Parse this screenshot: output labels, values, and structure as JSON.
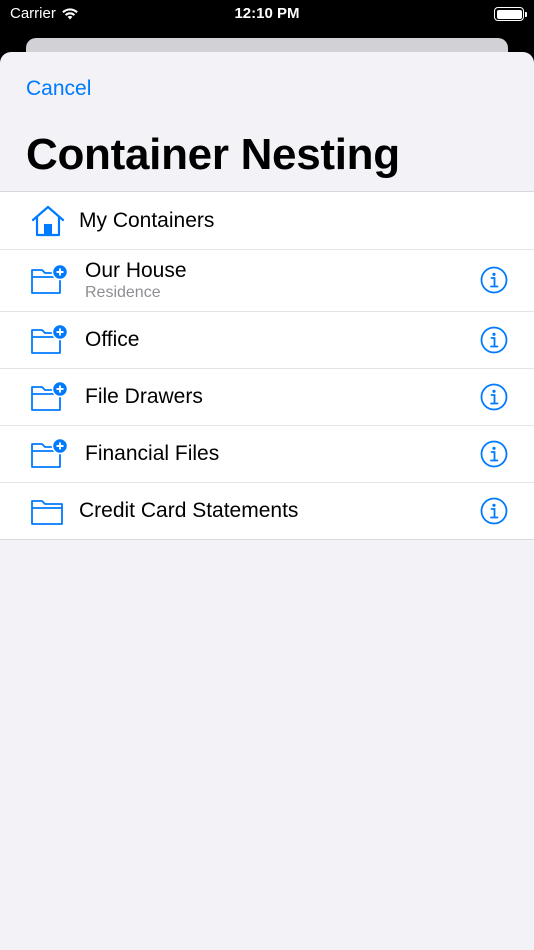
{
  "status_bar": {
    "carrier": "Carrier",
    "time": "12:10 PM",
    "battery_level": 1.0
  },
  "nav": {
    "cancel_label": "Cancel",
    "title": "Container Nesting"
  },
  "colors": {
    "accent": "#007aff",
    "sheet_bg": "#f2f2f7",
    "subtitle": "#8e8e93"
  },
  "list": {
    "items": [
      {
        "title": "My Containers",
        "icon": "house-icon"
      },
      {
        "title": "Our House",
        "subtitle": "Residence",
        "icon": "folder-add-icon"
      },
      {
        "title": "Office",
        "icon": "folder-add-icon"
      },
      {
        "title": "File Drawers",
        "icon": "folder-add-icon"
      },
      {
        "title": "Financial Files",
        "icon": "folder-add-icon"
      },
      {
        "title": "Credit Card Statements",
        "icon": "folder-icon"
      }
    ]
  }
}
